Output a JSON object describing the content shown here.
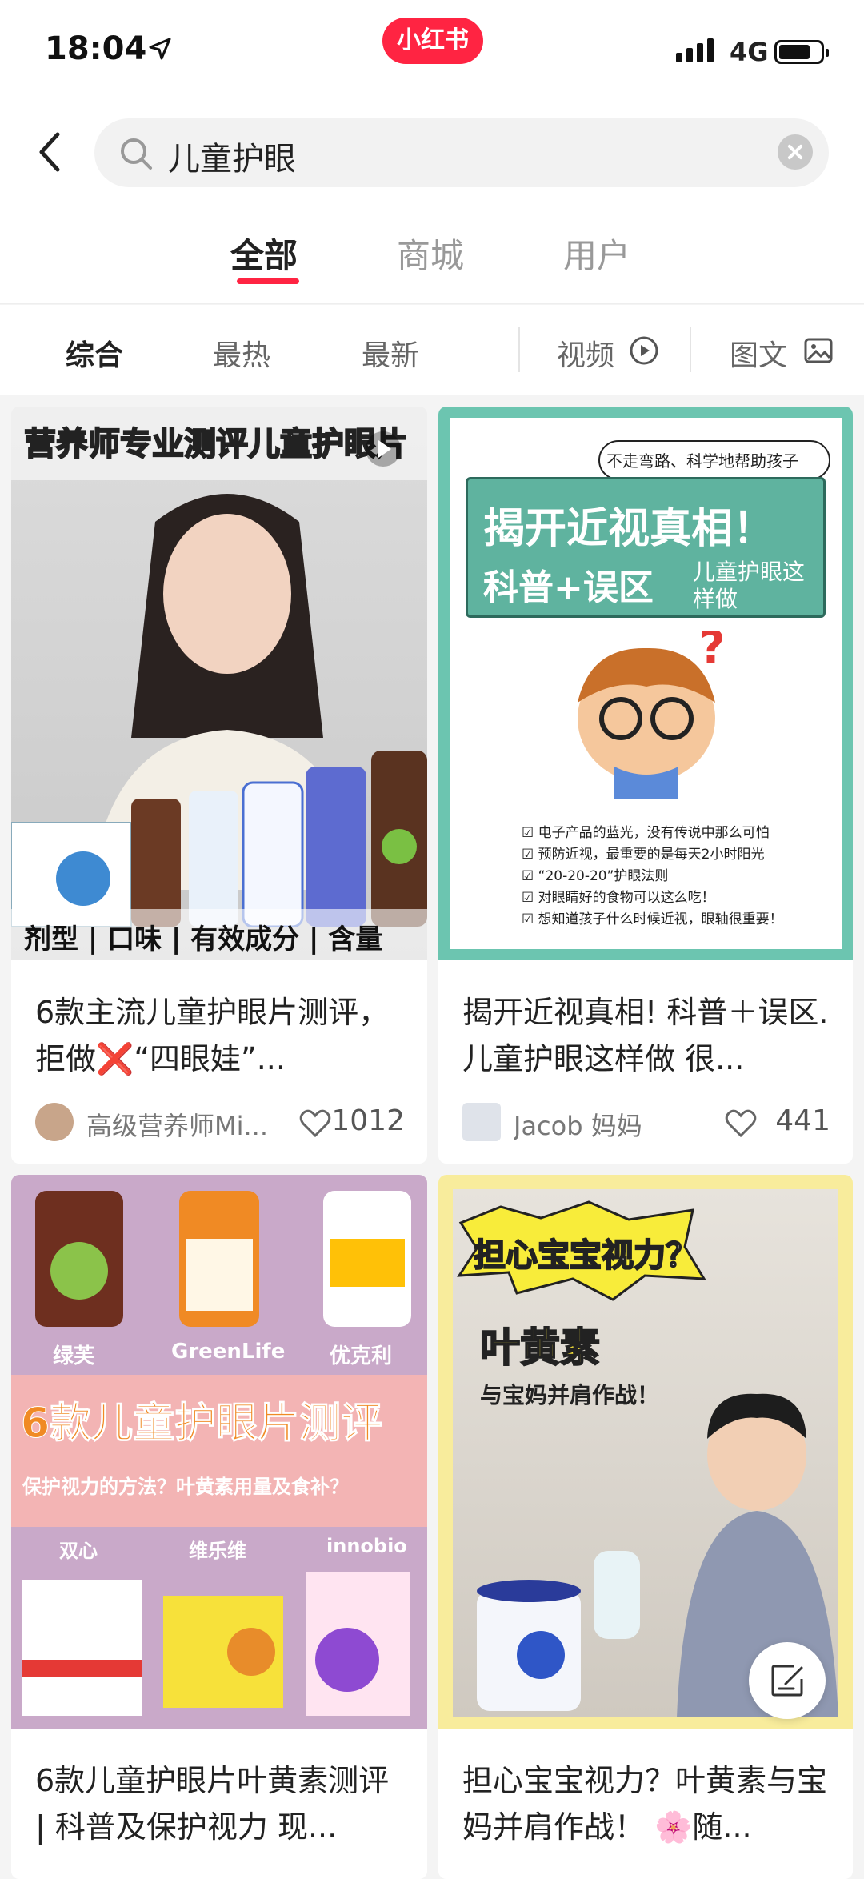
{
  "status_bar": {
    "time": "18:04",
    "network": "4G"
  },
  "brand": {
    "logo_text": "小红书"
  },
  "search": {
    "query": "儿童护眼"
  },
  "tabs": [
    {
      "label": "全部"
    },
    {
      "label": "商城"
    },
    {
      "label": "用户"
    }
  ],
  "filters": [
    {
      "label": "综合"
    },
    {
      "label": "最热"
    },
    {
      "label": "最新"
    },
    {
      "label": "视频"
    },
    {
      "label": "图文"
    }
  ],
  "posts": [
    {
      "banner": "营养师专业测评儿童护眼片",
      "footer": "剂型 | 口味 | 有效成分 | 含量",
      "title": "6款主流儿童护眼片测评，拒做❌“四眼娃”...",
      "author": "高级营养师Mi...",
      "likes": "1012"
    },
    {
      "header_note": "不走弯路、科学地帮助孩子",
      "headline": "揭开近视真相！",
      "subline": "科普+误区",
      "side_note": "儿童护眼这样做",
      "bullets": [
        "电子产品的蓝光，没有传说中那么可怕",
        "预防近视，最重要的是每天2小时阳光",
        "“20-20-20”护眼法则",
        "对眼睛好的食物可以这么吃！",
        "想知道孩子什么时候近视，眼轴很重要！"
      ],
      "title": "揭开近视真相! 科普＋误区. 儿童护眼这样做 很...",
      "author": "Jacob 妈妈",
      "likes": "441"
    },
    {
      "brands_top": [
        "绿芙",
        "GreenLife",
        "优克利"
      ],
      "headline": "6款儿童护眼片测评",
      "subline": "保护视力的方法？叶黄素用量及食补？",
      "brands_bottom": [
        "双心",
        "维乐维",
        "innobio"
      ],
      "title": "6款儿童护眼片叶黄素测评 | 科普及保护视力 现..."
    },
    {
      "bubble": "担心宝宝视力？",
      "headline": "叶黄素",
      "subline": "与宝妈并肩作战！",
      "title": "担心宝宝视力？叶黄素与宝妈并肩作战！ 🌸随..."
    }
  ],
  "colors": {
    "accent": "#ff2442",
    "teal": "#6cc5b0",
    "lavender": "#c9a9c9"
  }
}
